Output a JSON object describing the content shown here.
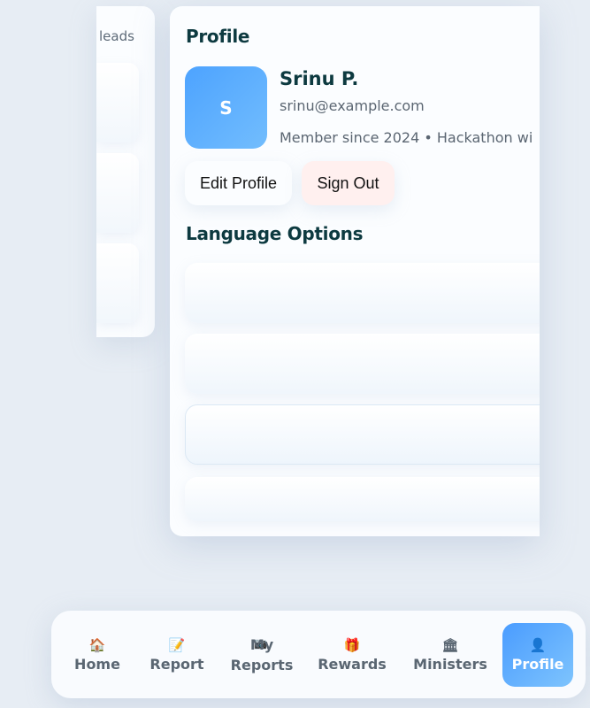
{
  "left_card": {
    "partial_text": "leads"
  },
  "profile": {
    "heading": "Profile",
    "avatar_initial": "S",
    "name": "Srinu P.",
    "email": "srinu@example.com",
    "meta": "Member since 2024 • Hackathon wi",
    "edit_label": "Edit Profile",
    "signout_label": "Sign Out"
  },
  "language": {
    "heading": "Language Options"
  },
  "nav": {
    "items": [
      {
        "icon": "🏠",
        "label": "Home"
      },
      {
        "icon": "📝",
        "label": "Report"
      },
      {
        "icon": "📷",
        "label": "My Reports"
      },
      {
        "icon": "🎁",
        "label": "Rewards"
      },
      {
        "icon": "🏛",
        "label": "Ministers"
      },
      {
        "icon": "👤",
        "label": "Profile"
      }
    ],
    "active": "Profile"
  },
  "colors": {
    "accent": "#4a9cff",
    "heading": "#0d3a40",
    "signout_bg": "#fff0ef"
  }
}
